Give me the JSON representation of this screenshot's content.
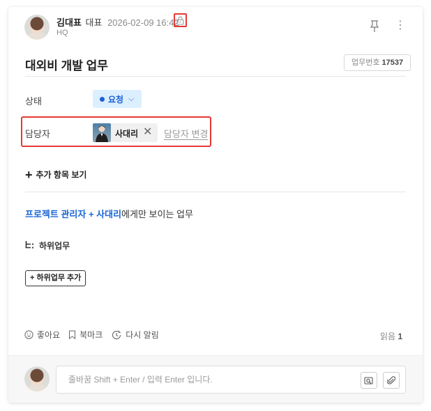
{
  "header": {
    "author_name": "김대표",
    "author_role": "대표",
    "timestamp": "2026-02-09 16:42",
    "org": "HQ",
    "icons": [
      "lock-icon",
      "pin-icon",
      "more-vertical-icon"
    ]
  },
  "task": {
    "title": "대외비 개발 업무",
    "number_label": "업무번호",
    "number_value": "17537"
  },
  "fields": {
    "status_label": "상태",
    "status_value": "요청",
    "assignee_label": "담당자",
    "assignee_name": "사대리",
    "assignee_remove": "✕",
    "assignee_change": "담당자 변경"
  },
  "more_items": {
    "plus": "+",
    "label": "추가 항목 보기"
  },
  "visibility": {
    "highlight": "프로젝트 관리자 + 사대리",
    "suffix": "에게만 보이는 업무"
  },
  "subtasks": {
    "label": "하위업무",
    "add_label": "+ 하위업무 추가"
  },
  "actions": {
    "like": "좋아요",
    "bookmark": "북마크",
    "remind": "다시 알림",
    "reads_label": "읽음",
    "reads_count": "1"
  },
  "comment": {
    "placeholder": "줄바꿈 Shift + Enter / 입력 Enter 입니다."
  },
  "colors": {
    "accent_blue": "#1c5fd6",
    "status_bg": "#dcefff",
    "highlight_red": "#e53935"
  }
}
